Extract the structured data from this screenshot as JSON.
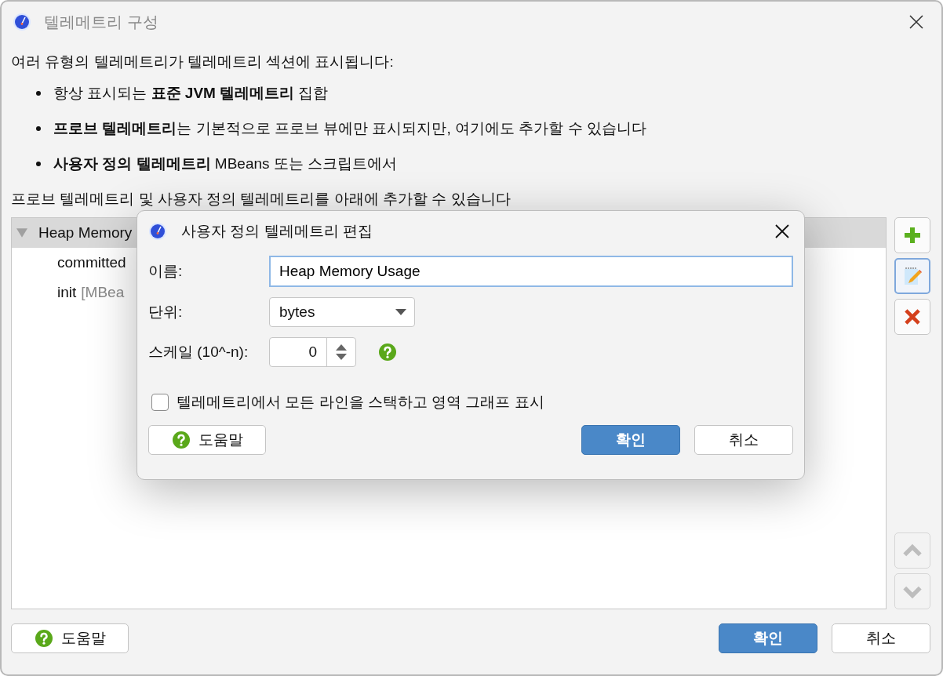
{
  "window": {
    "title": "텔레메트리 구성"
  },
  "intro": "여러 유형의 텔레메트리가 텔레메트리 섹션에 표시됩니다:",
  "bullets": [
    "항상 표시되는 **표준 JVM 텔레메트리** 집합",
    "**프로브 텔레메트리**는 기본적으로 프로브 뷰에만 표시되지만, 여기에도 추가할 수 있습니다",
    "**사용자 정의 텔레메트리** MBeans 또는 스크립트에서"
  ],
  "note": "프로브 텔레메트리 및 사용자 정의 텔레메트리를 아래에 추가할 수 있습니다",
  "tree": [
    {
      "label": "Heap Memory",
      "expanded": true,
      "selected": true,
      "children": [
        {
          "label": "committed"
        },
        {
          "label": "init",
          "detail": "[MBea"
        }
      ]
    }
  ],
  "side_buttons": [
    {
      "kind": "add",
      "disabled": false,
      "focused": false
    },
    {
      "kind": "edit",
      "disabled": false,
      "focused": true
    },
    {
      "kind": "delete",
      "disabled": false,
      "focused": false
    },
    {
      "kind": "up",
      "disabled": true,
      "focused": false
    },
    {
      "kind": "down",
      "disabled": true,
      "focused": false
    }
  ],
  "buttons": [
    {
      "kind": "help",
      "label": "도움말"
    },
    {
      "kind": "ok",
      "label": "확인"
    },
    {
      "kind": "cancel",
      "label": "취소"
    }
  ],
  "dialog": {
    "title": "사용자 정의 텔레메트리 편집",
    "name_label": "이름:",
    "name_value": "Heap Memory Usage",
    "unit_label": "단위:",
    "unit_value": "bytes",
    "scale_label": "스케일 (10^-n):",
    "scale_value": "0",
    "stack_checkbox": {
      "label": "텔레메트리에서 모든 라인을 스택하고 영역 그래프 표시",
      "checked": false
    },
    "buttons": [
      {
        "kind": "help",
        "label": "도움말"
      },
      {
        "kind": "ok",
        "label": "확인"
      },
      {
        "kind": "cancel",
        "label": "취소"
      }
    ]
  }
}
